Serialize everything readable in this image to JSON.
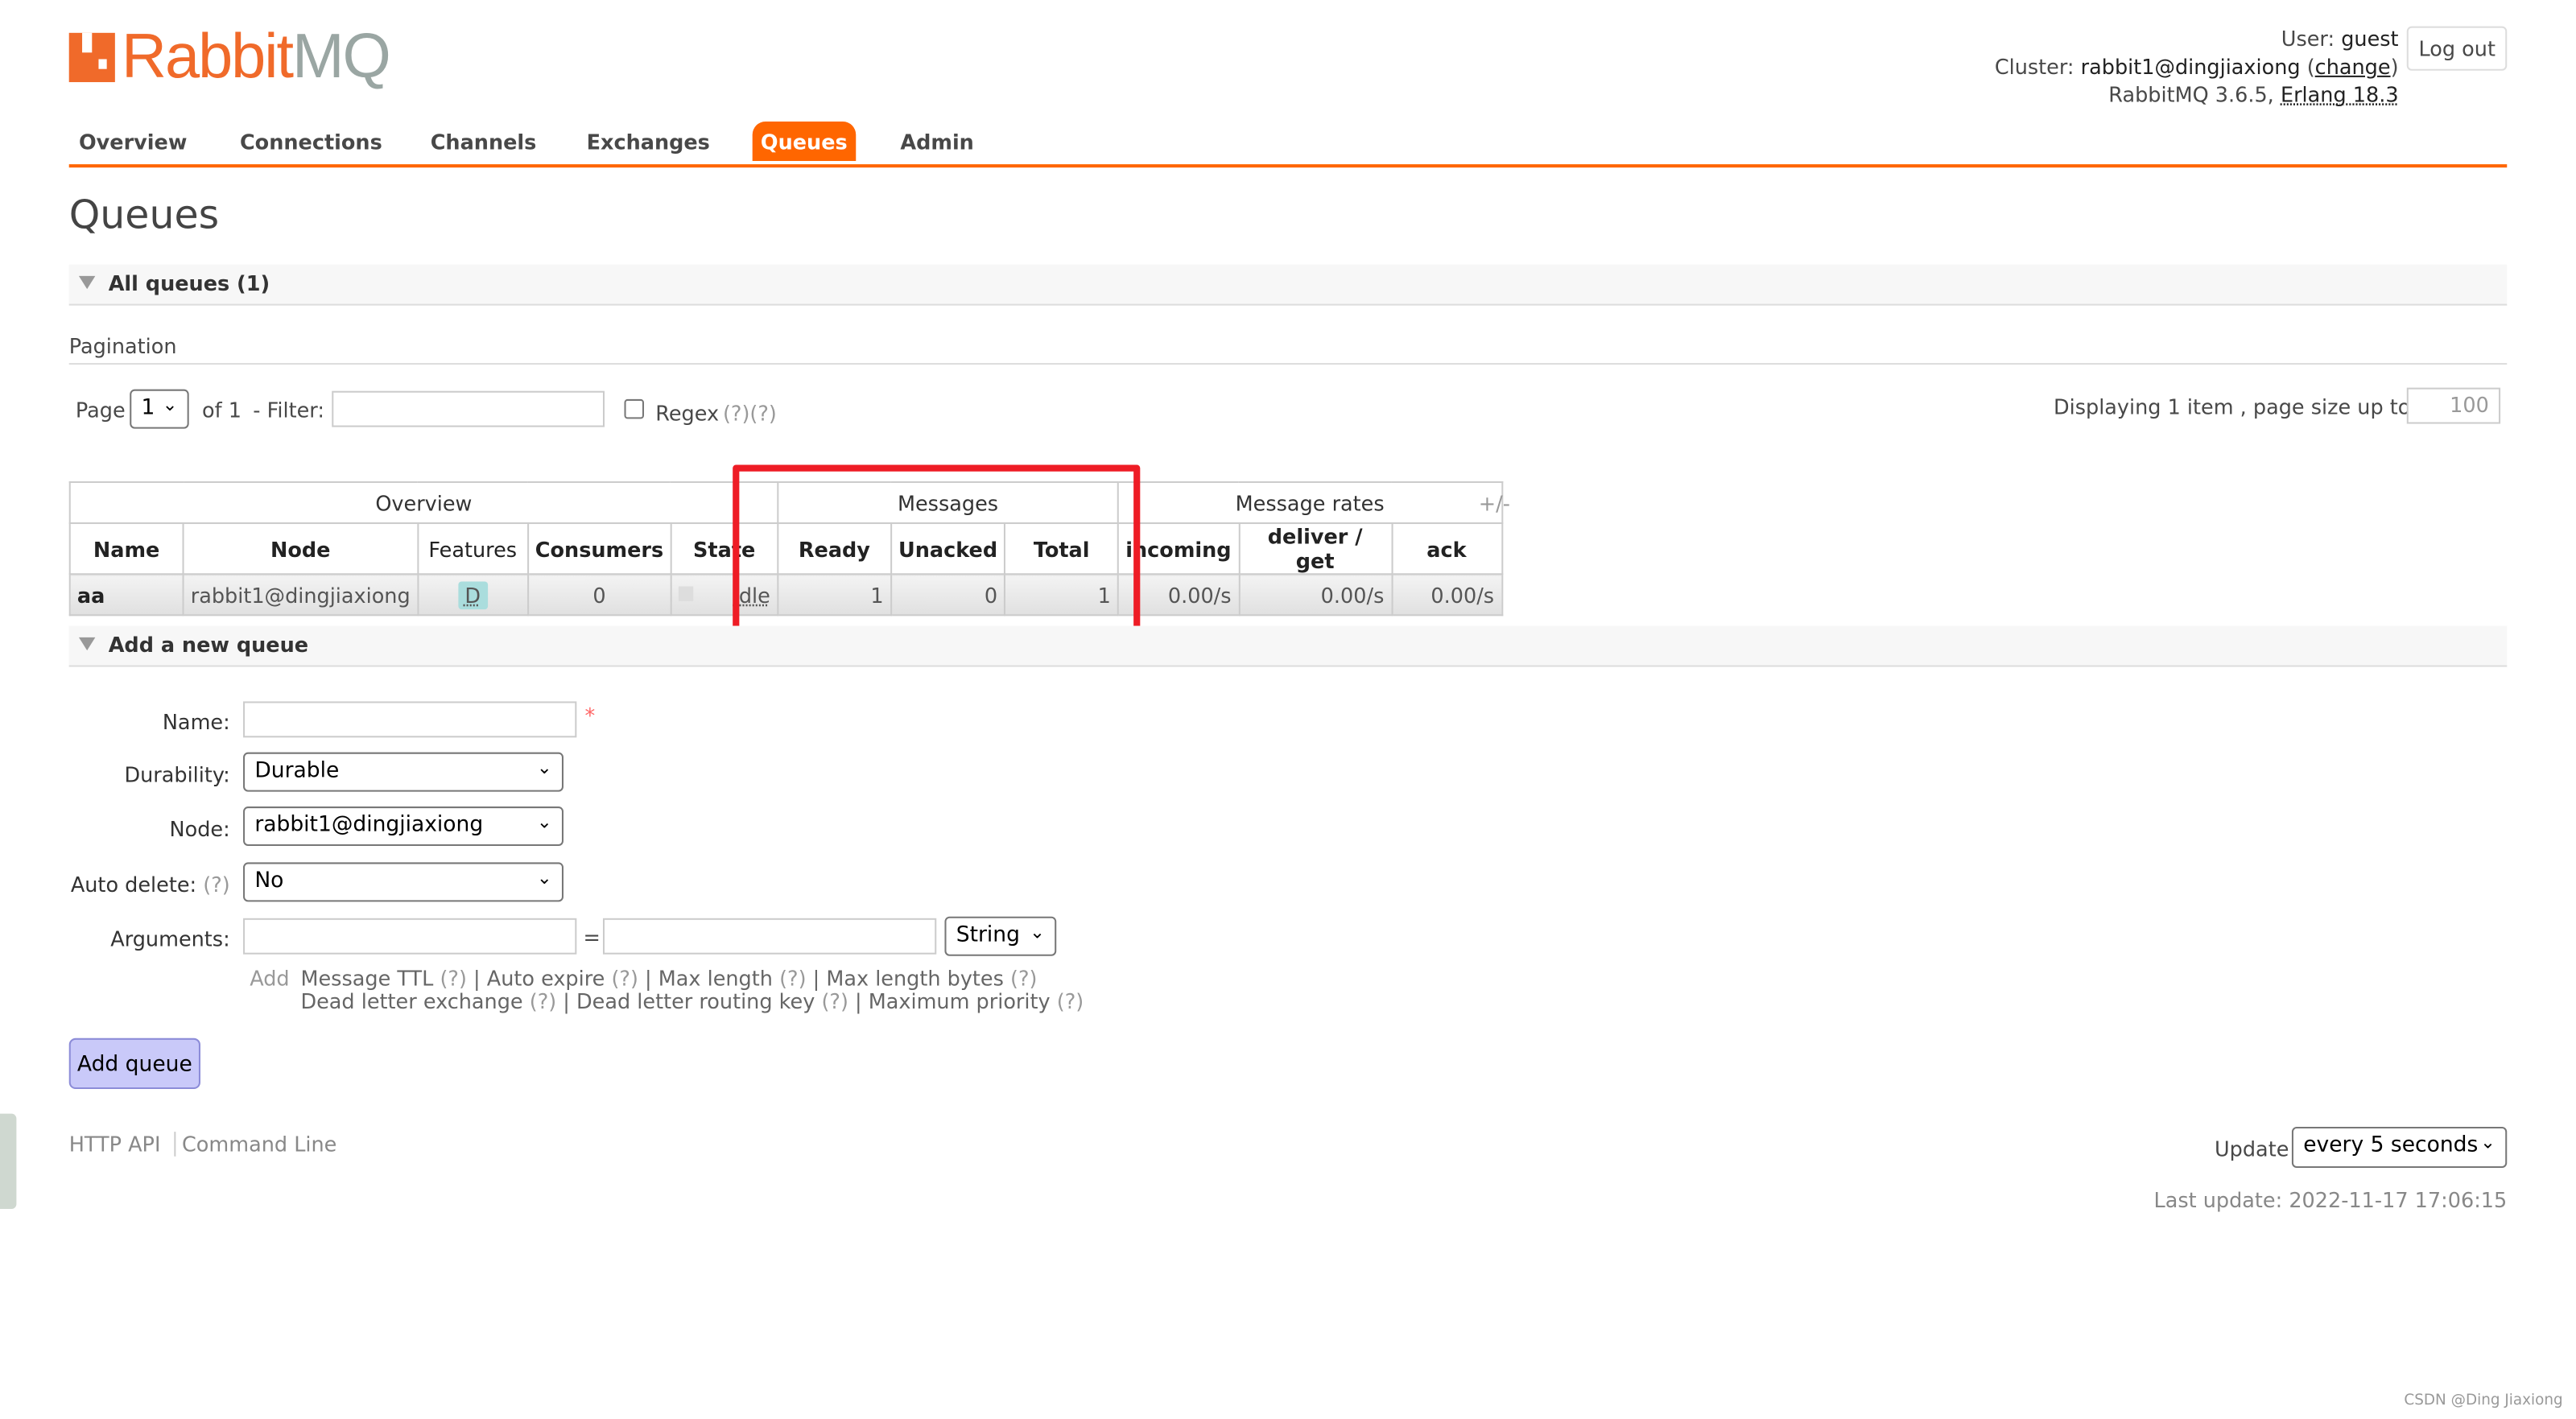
{
  "brand": {
    "logo_text_1": "Rabbit",
    "logo_text_2": "MQ",
    "accent": "#ff6600"
  },
  "header": {
    "user_label": "User:",
    "user": "guest",
    "cluster_label": "Cluster:",
    "cluster": "rabbit1@dingjiaxiong",
    "change": "change",
    "version": "RabbitMQ 3.6.5,",
    "erlang": "Erlang 18.3",
    "logout": "Log out"
  },
  "nav": [
    "Overview",
    "Connections",
    "Channels",
    "Exchanges",
    "Queues",
    "Admin"
  ],
  "page_title": "Queues",
  "all_queues": "All queues (1)",
  "pagination": {
    "title": "Pagination",
    "page_label": "Page",
    "page_value": "1",
    "of": "of 1",
    "filter_label": "- Filter:",
    "filter_value": "",
    "regex_label": "Regex",
    "regex_help": "(?)(?)",
    "displaying": "Displaying 1 item , page size up to:",
    "page_size": "100"
  },
  "table": {
    "groups": [
      "Overview",
      "Messages",
      "Message rates"
    ],
    "plusminus": "+/-",
    "columns": [
      "Name",
      "Node",
      "Features",
      "Consumers",
      "State",
      "Ready",
      "Unacked",
      "Total",
      "incoming",
      "deliver / get",
      "ack"
    ],
    "rows": [
      {
        "name": "aa",
        "node": "rabbit1@dingjiaxiong",
        "features": "D",
        "consumers": "0",
        "state": "idle",
        "ready": "1",
        "unacked": "0",
        "total": "1",
        "incoming": "0.00/s",
        "deliver": "0.00/s",
        "ack": "0.00/s"
      }
    ]
  },
  "add_queue": {
    "title": "Add a new queue",
    "name_label": "Name:",
    "name_value": "",
    "required": "*",
    "durability_label": "Durability:",
    "durability": "Durable",
    "node_label": "Node:",
    "node": "rabbit1@dingjiaxiong",
    "auto_delete_label": "Auto delete:",
    "help": "(?)",
    "auto_delete": "No",
    "arguments_label": "Arguments:",
    "eq": "=",
    "arg_type": "String",
    "add": "Add",
    "hints1": [
      "Message TTL",
      "Auto expire",
      "Max length",
      "Max length bytes"
    ],
    "hints2": [
      "Dead letter exchange",
      "Dead letter routing key",
      "Maximum priority"
    ],
    "button": "Add queue"
  },
  "footer": {
    "http_api": "HTTP API",
    "command_line": "Command Line",
    "update_label": "Update",
    "update_value": "every 5 seconds",
    "last_update": "Last update: 2022-11-17 17:06:15",
    "watermark": "CSDN @Ding Jiaxiong"
  }
}
